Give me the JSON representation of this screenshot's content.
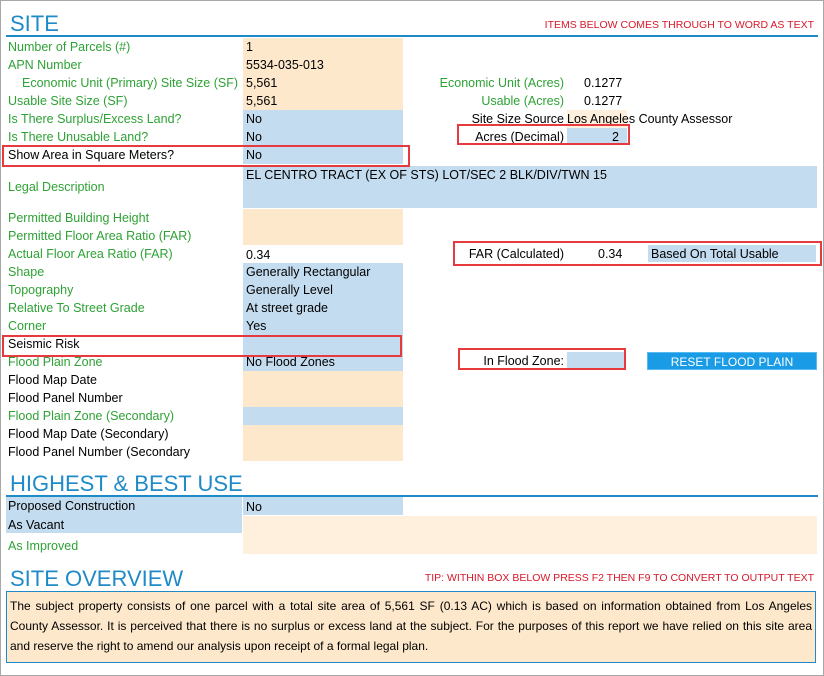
{
  "site": {
    "title": "SITE",
    "note": "ITEMS BELOW COMES THROUGH TO WORD AS TEXT",
    "rows": {
      "number_of_parcels": {
        "label": "Number of Parcels (#)",
        "value": "1"
      },
      "apn_number": {
        "label": "APN Number",
        "value": "5534-035-013"
      },
      "economic_unit_sf": {
        "label": "Economic Unit (Primary) Site Size (SF)",
        "value": "5,561"
      },
      "usable_site_size": {
        "label": "Usable Site Size (SF)",
        "value": "5,561"
      },
      "surplus_land": {
        "label": "Is There Surplus/Excess Land?",
        "value": "No"
      },
      "unusable_land": {
        "label": "Is There Unusable Land?",
        "value": "No"
      },
      "show_area_sqm": {
        "label": "Show Area in Square Meters?",
        "value": "No"
      },
      "legal_description": {
        "label": "Legal Description",
        "value": "EL CENTRO TRACT (EX OF STS) LOT/SEC 2 BLK/DIV/TWN 15"
      },
      "permitted_height": {
        "label": "Permitted Building Height",
        "value": ""
      },
      "permitted_far": {
        "label": "Permitted Floor Area Ratio (FAR)",
        "value": ""
      },
      "actual_far": {
        "label": "Actual Floor Area Ratio (FAR)",
        "value": "0.34"
      },
      "shape": {
        "label": "Shape",
        "value": "Generally Rectangular"
      },
      "topography": {
        "label": "Topography",
        "value": "Generally Level"
      },
      "street_grade": {
        "label": "Relative To Street Grade",
        "value": "At street grade"
      },
      "corner": {
        "label": "Corner",
        "value": "Yes"
      },
      "seismic_risk": {
        "label": "Seismic Risk",
        "value": ""
      },
      "flood_plain_zone": {
        "label": "Flood Plain Zone",
        "value": "No Flood Zones"
      },
      "flood_map_date": {
        "label": "Flood Map Date",
        "value": ""
      },
      "flood_panel_number": {
        "label": "Flood Panel Number",
        "value": ""
      },
      "flood_plain_zone_secondary": {
        "label": "Flood Plain Zone (Secondary)",
        "value": ""
      },
      "flood_map_date_secondary": {
        "label": "Flood Map Date (Secondary)",
        "value": ""
      },
      "flood_panel_number_secondary": {
        "label": "Flood Panel Number (Secondary",
        "value": ""
      }
    },
    "right": {
      "economic_unit_acres": {
        "label": "Economic Unit (Acres)",
        "value": "0.1277"
      },
      "usable_acres": {
        "label": "Usable (Acres)",
        "value": "0.1277"
      },
      "site_size_source": {
        "label": "Site Size Source",
        "value": "Los Angeles County Assessor"
      },
      "acres_decimal": {
        "label": "Acres (Decimal)",
        "value": "2"
      },
      "far_calculated": {
        "label": "FAR (Calculated)",
        "value": "0.34",
        "basis": "Based On Total Usable"
      },
      "in_flood_zone": {
        "label": "In Flood Zone:",
        "value": ""
      },
      "reset_button": "RESET FLOOD PLAIN"
    }
  },
  "hbu": {
    "title": "HIGHEST & BEST USE",
    "proposed_construction": {
      "label": "Proposed Construction",
      "value": "No"
    },
    "as_vacant": {
      "label": "As Vacant",
      "value": ""
    },
    "as_improved": {
      "label": "As Improved",
      "value": ""
    }
  },
  "overview": {
    "title": "SITE OVERVIEW",
    "tip": "TIP: WITHIN BOX BELOW PRESS F2 THEN F9 TO CONVERT TO OUTPUT TEXT",
    "text": "The subject property consists of one parcel with a total site area of 5,561 SF (0.13 AC) which is based on information obtained from Los Angeles County Assessor. It is perceived that there is no surplus or excess land at the subject. For the purposes of this report we have relied on this site area and reserve the right to amend our analysis upon receipt of a formal legal plan."
  },
  "colors": {
    "accent_blue": "#1f8ac8",
    "label_green": "#2ea235",
    "note_red": "#d8182a",
    "highlight_red": "#e63a3f",
    "input_peach": "#fde8cc",
    "input_blue": "#c4dcef",
    "button_blue": "#1a9be6"
  }
}
